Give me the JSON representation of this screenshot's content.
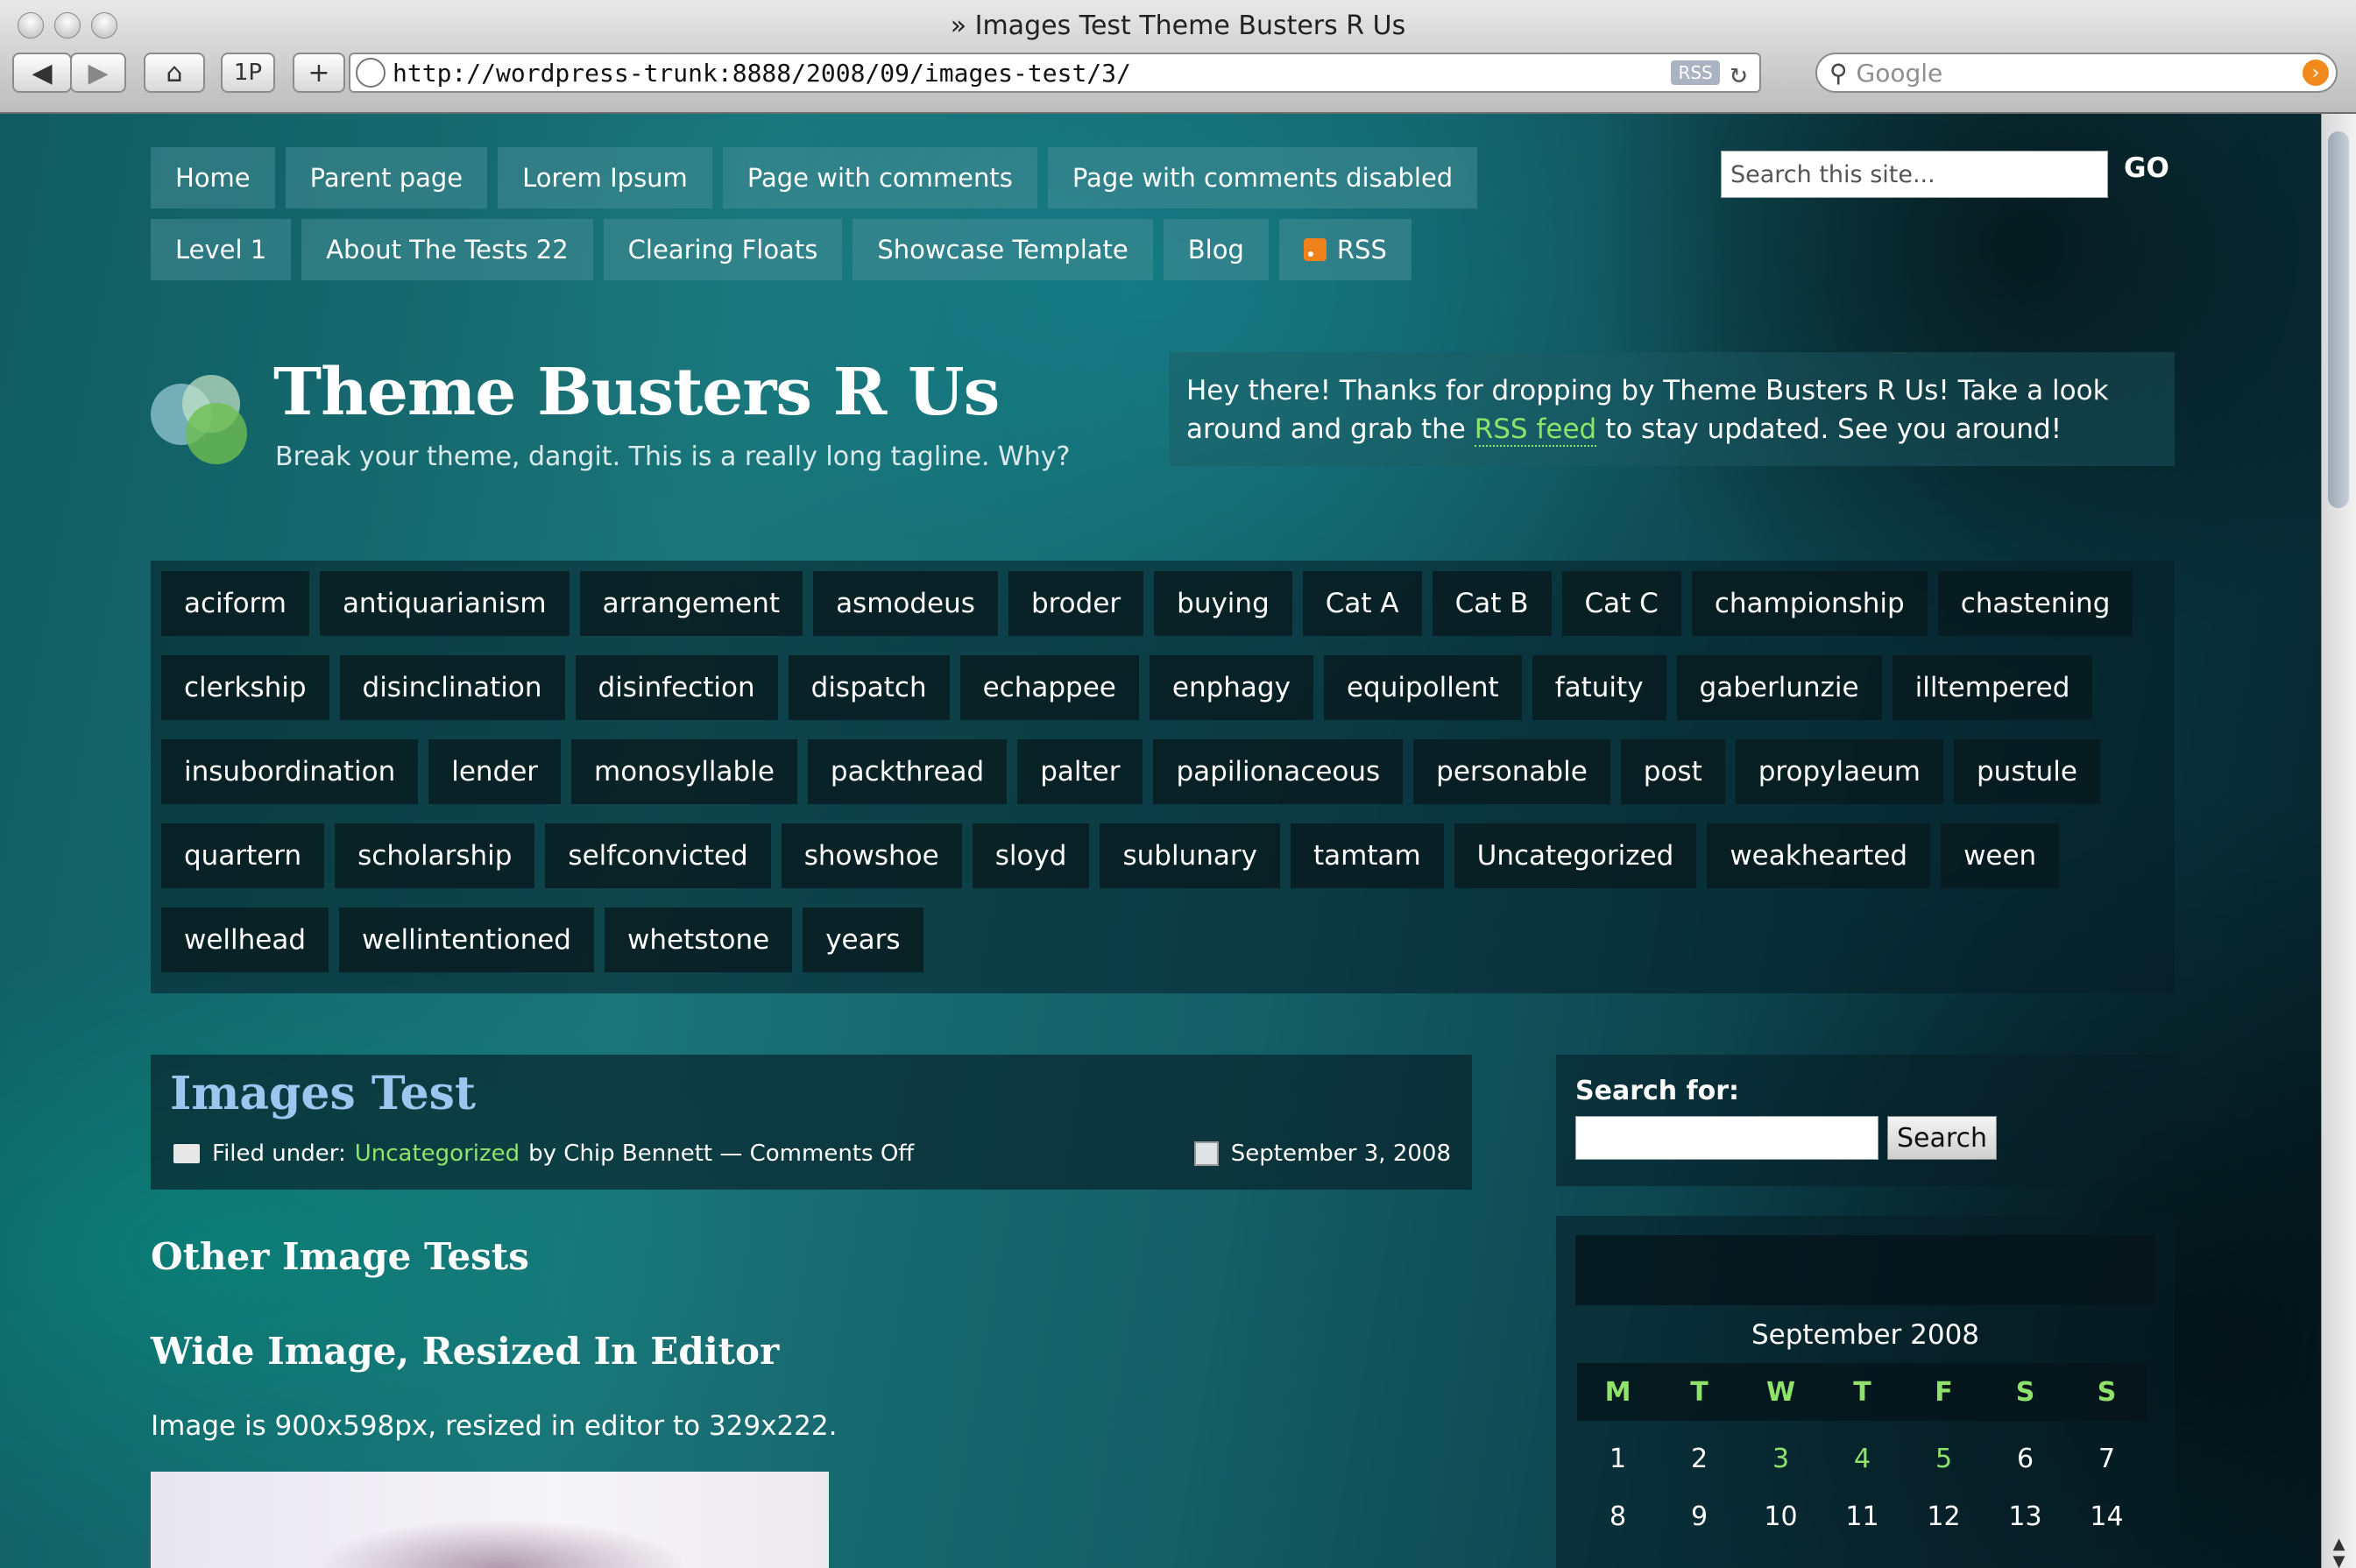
{
  "browser": {
    "window_title": "» Images Test Theme Busters R Us",
    "url": "http://wordpress-trunk:8888/2008/09/images-test/3/",
    "rss_badge": "RSS",
    "search_placeholder": "Google",
    "buttons": {
      "back": "◀",
      "forward": "▶",
      "home": "⌂",
      "bookmark": "1P",
      "add": "+"
    }
  },
  "nav": {
    "row1": [
      "Home",
      "Parent page",
      "Lorem Ipsum",
      "Page with comments",
      "Page with comments disabled"
    ],
    "row2": [
      "Level 1",
      "About The Tests 22",
      "Clearing Floats",
      "Showcase Template",
      "Blog"
    ],
    "rss_label": "RSS",
    "search_placeholder": "Search this site...",
    "go_label": "GO"
  },
  "header": {
    "title": "Theme Busters R Us",
    "tagline": "Break your theme, dangit. This is a really long tagline. Why?",
    "welcome_pre": "Hey there! Thanks for dropping by Theme Busters R Us! Take a look around and grab the ",
    "welcome_link": "RSS feed",
    "welcome_post": " to stay updated. See you around!"
  },
  "tags": [
    [
      "aciform",
      "antiquarianism",
      "arrangement",
      "asmodeus",
      "broder",
      "buying",
      "Cat A",
      "Cat B",
      "Cat C",
      "championship",
      "chastening"
    ],
    [
      "clerkship",
      "disinclination",
      "disinfection",
      "dispatch",
      "echappee",
      "enphagy",
      "equipollent",
      "fatuity",
      "gaberlunzie",
      "illtempered"
    ],
    [
      "insubordination",
      "lender",
      "monosyllable",
      "packthread",
      "palter",
      "papilionaceous",
      "personable",
      "post",
      "propylaeum",
      "pustule"
    ],
    [
      "quartern",
      "scholarship",
      "selfconvicted",
      "showshoe",
      "sloyd",
      "sublunary",
      "tamtam",
      "Uncategorized",
      "weakhearted",
      "ween"
    ],
    [
      "wellhead",
      "wellintentioned",
      "whetstone",
      "years"
    ]
  ],
  "post": {
    "title": "Images Test",
    "filed_under": "Filed under:",
    "category": "Uncategorized",
    "byline": "by Chip Bennett — Comments Off",
    "date": "September 3, 2008",
    "h_other": "Other Image Tests",
    "h_wide": "Wide Image, Resized In Editor",
    "desc": "Image is 900x598px, resized in editor to 329x222."
  },
  "sidebar": {
    "search_label": "Search for:",
    "search_button": "Search",
    "calendar": {
      "caption": "September 2008",
      "weekdays": [
        "M",
        "T",
        "W",
        "T",
        "F",
        "S",
        "S"
      ],
      "weeks": [
        [
          "1",
          "2",
          "3",
          "4",
          "5",
          "6",
          "7"
        ],
        [
          "8",
          "9",
          "10",
          "11",
          "12",
          "13",
          "14"
        ]
      ],
      "linked_days": [
        "3",
        "4",
        "5"
      ]
    }
  },
  "colors": {
    "link_green": "#8fe36b",
    "title_blue": "#9cc6f0",
    "rss_orange": "#f0811b"
  }
}
